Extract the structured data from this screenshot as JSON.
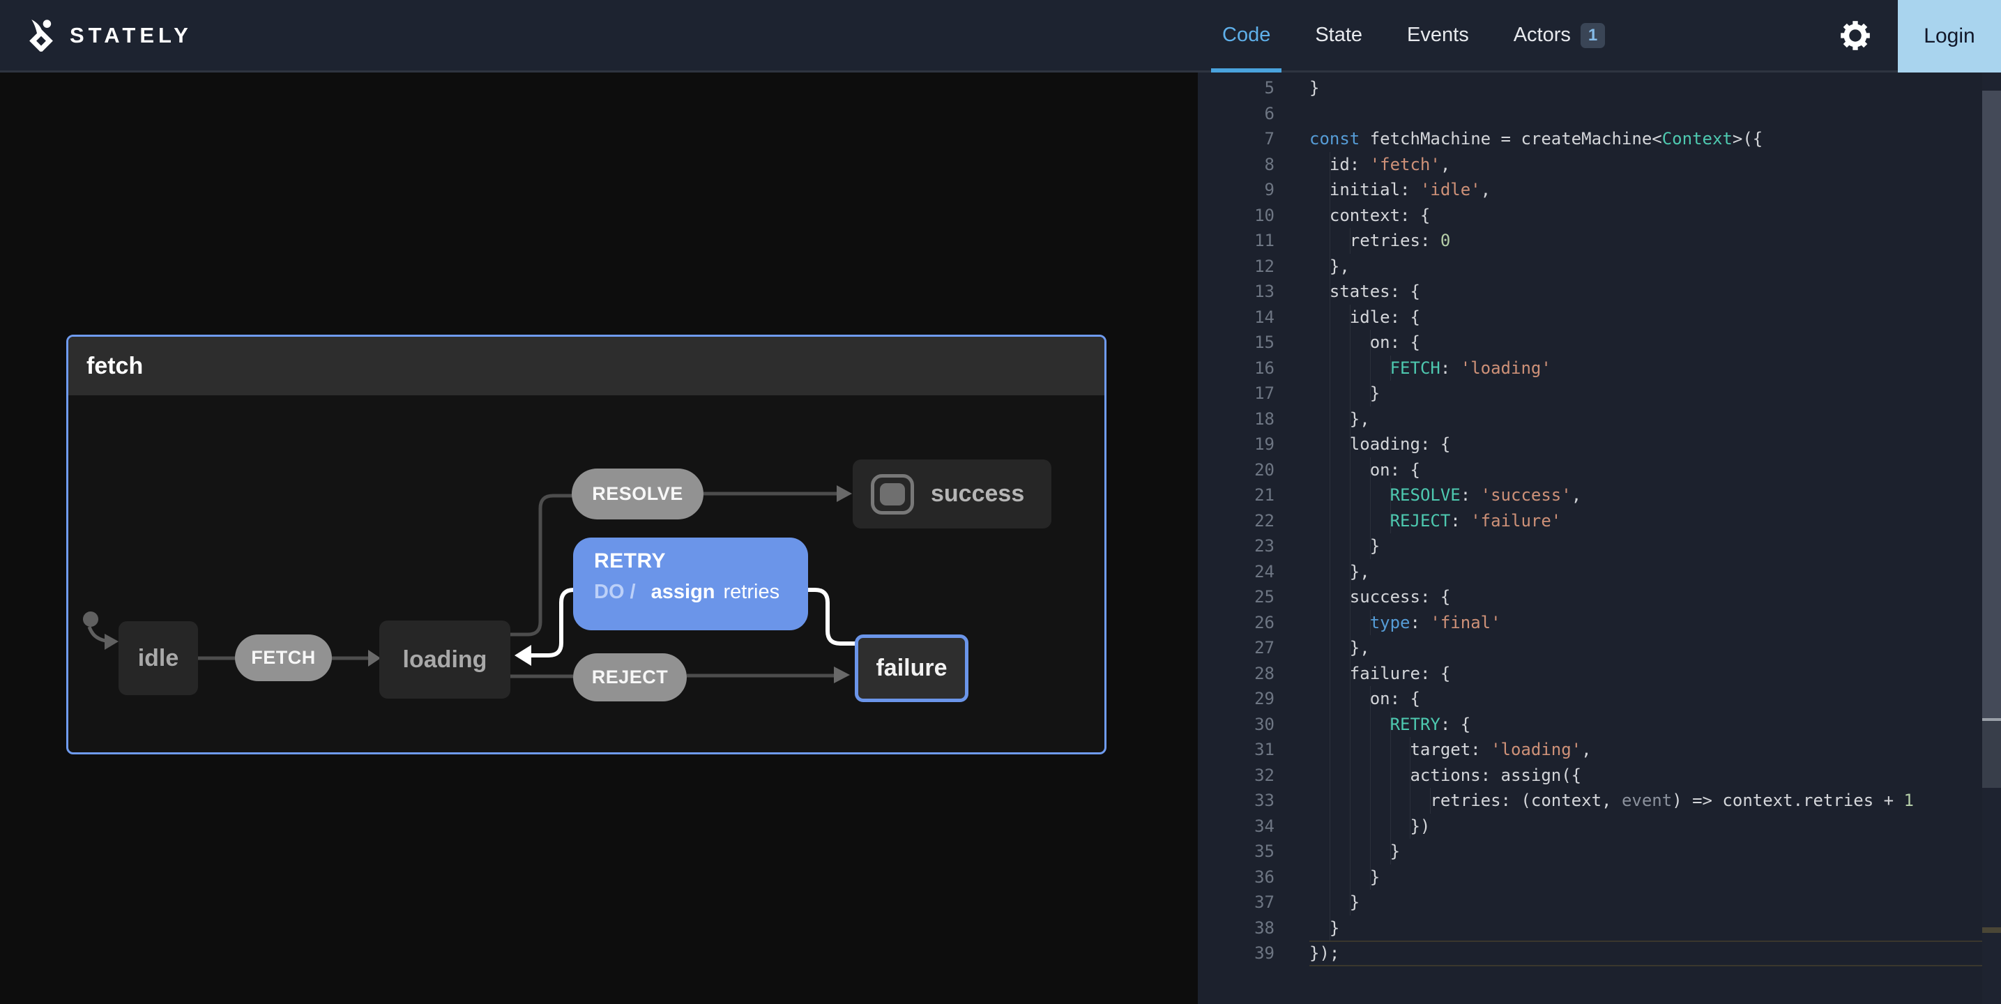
{
  "topbar": {
    "brand": "STATELY",
    "tabs": [
      {
        "label": "Code",
        "active": true
      },
      {
        "label": "State",
        "active": false
      },
      {
        "label": "Events",
        "active": false
      },
      {
        "label": "Actors",
        "active": false,
        "badge": "1"
      }
    ],
    "actors_badge": "1",
    "login_label": "Login"
  },
  "colors": {
    "accent_blue": "#6b95e9",
    "machine_border_blue": "#6f9bef",
    "active_tab_blue": "#5fb0ea",
    "login_bg": "#a9d4ee",
    "topbar_bg": "#1d2330",
    "editor_bg": "#1c212d",
    "event_pill_gray": "#929292"
  },
  "diagram": {
    "machine_title": "fetch",
    "states": {
      "idle": "idle",
      "loading": "loading",
      "success": "success",
      "failure": "failure"
    },
    "events": {
      "fetch": "FETCH",
      "resolve": "RESOLVE",
      "reject": "REJECT",
      "retry": "RETRY"
    },
    "retry_action": {
      "do_label": "DO /",
      "action_bold": "assign",
      "action_rest": "retries"
    }
  },
  "editor": {
    "lines": [
      {
        "n": 5,
        "indent": 0,
        "tokens": [
          [
            "w",
            "}"
          ]
        ]
      },
      {
        "n": 6,
        "indent": 0,
        "tokens": []
      },
      {
        "n": 7,
        "indent": 0,
        "tokens": [
          [
            "kw",
            "const"
          ],
          [
            "w",
            " fetchMachine = createMachine<"
          ],
          [
            "tl",
            "Context"
          ],
          [
            "w",
            ">({"
          ]
        ]
      },
      {
        "n": 8,
        "indent": 1,
        "tokens": [
          [
            "w",
            "id: "
          ],
          [
            "str",
            "'fetch'"
          ],
          [
            "w",
            ","
          ]
        ]
      },
      {
        "n": 9,
        "indent": 1,
        "tokens": [
          [
            "w",
            "initial: "
          ],
          [
            "str",
            "'idle'"
          ],
          [
            "w",
            ","
          ]
        ]
      },
      {
        "n": 10,
        "indent": 1,
        "tokens": [
          [
            "w",
            "context: {"
          ]
        ]
      },
      {
        "n": 11,
        "indent": 2,
        "tokens": [
          [
            "w",
            "retries: "
          ],
          [
            "num",
            "0"
          ]
        ]
      },
      {
        "n": 12,
        "indent": 1,
        "tokens": [
          [
            "w",
            "},"
          ]
        ]
      },
      {
        "n": 13,
        "indent": 1,
        "tokens": [
          [
            "w",
            "states: {"
          ]
        ]
      },
      {
        "n": 14,
        "indent": 2,
        "tokens": [
          [
            "w",
            "idle: {"
          ]
        ]
      },
      {
        "n": 15,
        "indent": 3,
        "tokens": [
          [
            "w",
            "on: {"
          ]
        ]
      },
      {
        "n": 16,
        "indent": 4,
        "tokens": [
          [
            "tl",
            "FETCH"
          ],
          [
            "w",
            ": "
          ],
          [
            "str",
            "'loading'"
          ]
        ]
      },
      {
        "n": 17,
        "indent": 3,
        "tokens": [
          [
            "w",
            "}"
          ]
        ]
      },
      {
        "n": 18,
        "indent": 2,
        "tokens": [
          [
            "w",
            "},"
          ]
        ]
      },
      {
        "n": 19,
        "indent": 2,
        "tokens": [
          [
            "w",
            "loading: {"
          ]
        ]
      },
      {
        "n": 20,
        "indent": 3,
        "tokens": [
          [
            "w",
            "on: {"
          ]
        ]
      },
      {
        "n": 21,
        "indent": 4,
        "tokens": [
          [
            "tl",
            "RESOLVE"
          ],
          [
            "w",
            ": "
          ],
          [
            "str",
            "'success'"
          ],
          [
            "w",
            ","
          ]
        ]
      },
      {
        "n": 22,
        "indent": 4,
        "tokens": [
          [
            "tl",
            "REJECT"
          ],
          [
            "w",
            ": "
          ],
          [
            "str",
            "'failure'"
          ]
        ]
      },
      {
        "n": 23,
        "indent": 3,
        "tokens": [
          [
            "w",
            "}"
          ]
        ]
      },
      {
        "n": 24,
        "indent": 2,
        "tokens": [
          [
            "w",
            "},"
          ]
        ]
      },
      {
        "n": 25,
        "indent": 2,
        "tokens": [
          [
            "w",
            "success: {"
          ]
        ]
      },
      {
        "n": 26,
        "indent": 3,
        "tokens": [
          [
            "kw",
            "type"
          ],
          [
            "w",
            ": "
          ],
          [
            "str",
            "'final'"
          ]
        ]
      },
      {
        "n": 27,
        "indent": 2,
        "tokens": [
          [
            "w",
            "},"
          ]
        ]
      },
      {
        "n": 28,
        "indent": 2,
        "tokens": [
          [
            "w",
            "failure: {"
          ]
        ]
      },
      {
        "n": 29,
        "indent": 3,
        "tokens": [
          [
            "w",
            "on: {"
          ]
        ]
      },
      {
        "n": 30,
        "indent": 4,
        "tokens": [
          [
            "tl",
            "RETRY"
          ],
          [
            "w",
            ": {"
          ]
        ]
      },
      {
        "n": 31,
        "indent": 5,
        "tokens": [
          [
            "w",
            "target: "
          ],
          [
            "str",
            "'loading'"
          ],
          [
            "w",
            ","
          ]
        ]
      },
      {
        "n": 32,
        "indent": 5,
        "tokens": [
          [
            "w",
            "actions: assign({"
          ]
        ]
      },
      {
        "n": 33,
        "indent": 6,
        "tokens": [
          [
            "w",
            "retries: (context, "
          ],
          [
            "dim",
            "event"
          ],
          [
            "w",
            ") => context.retries + "
          ],
          [
            "num",
            "1"
          ]
        ]
      },
      {
        "n": 34,
        "indent": 5,
        "tokens": [
          [
            "w",
            "})"
          ]
        ]
      },
      {
        "n": 35,
        "indent": 4,
        "tokens": [
          [
            "w",
            "}"
          ]
        ]
      },
      {
        "n": 36,
        "indent": 3,
        "tokens": [
          [
            "w",
            "}"
          ]
        ]
      },
      {
        "n": 37,
        "indent": 2,
        "tokens": [
          [
            "w",
            "}"
          ]
        ]
      },
      {
        "n": 38,
        "indent": 1,
        "tokens": [
          [
            "w",
            "}"
          ]
        ]
      },
      {
        "n": 39,
        "indent": 0,
        "active": true,
        "tokens": [
          [
            "w",
            "});"
          ]
        ]
      }
    ]
  }
}
